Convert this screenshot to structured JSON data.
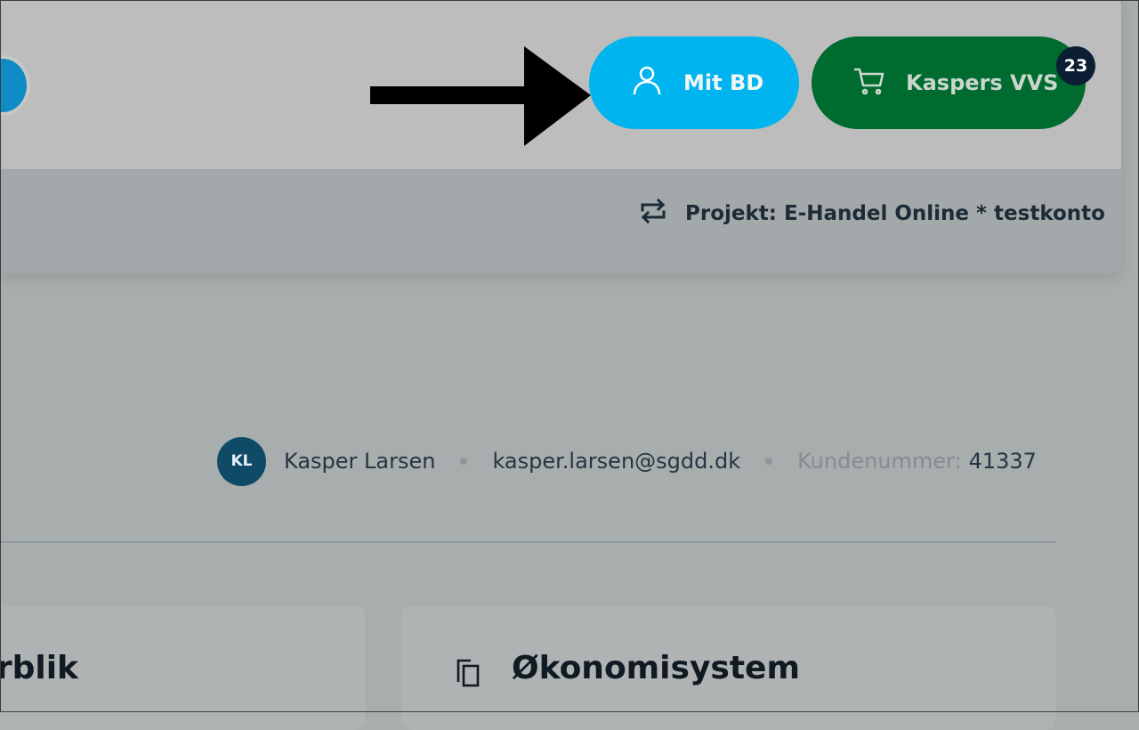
{
  "header": {
    "mit_bd_label": "Mit BD",
    "cart_label": "Kaspers VVS",
    "cart_count": "23",
    "project_text": "Projekt: E-Handel Online * testkonto"
  },
  "profile": {
    "initials": "KL",
    "name": "Kasper Larsen",
    "email": "kasper.larsen@sgdd.dk",
    "customer_label": "Kundenummer:",
    "customer_number": "41337"
  },
  "cards": {
    "left_title": "rblik",
    "right_title": "Økonomisystem"
  },
  "icons": {
    "user": "user-icon",
    "cart": "shopping-cart-icon",
    "swap": "swap-arrows-icon",
    "copy": "copy-documents-icon",
    "arrow": "right-arrow-icon"
  },
  "colors": {
    "mit_bd": "#00b4f0",
    "cart": "#006b2e",
    "badge": "#0c1e33",
    "avatar": "#0f4a66"
  }
}
